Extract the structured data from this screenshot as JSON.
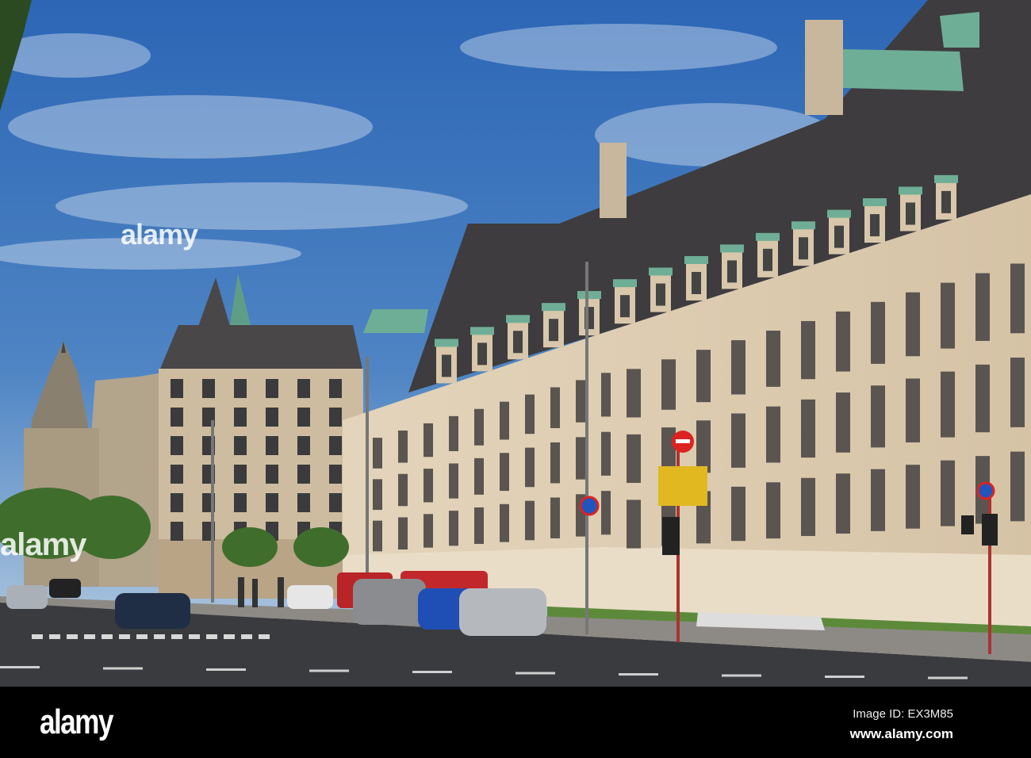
{
  "watermark": {
    "logo": "alamy",
    "image_id": "Image ID: EX3M85",
    "url": "www.alamy.com"
  },
  "colors": {
    "sky_top": "#2f6bb8",
    "sky_bottom": "#9fbbd8",
    "facade": "#dccbb0",
    "roof": "#3e3c3e",
    "copper": "#6fae96",
    "road": "#3a3b3e"
  }
}
